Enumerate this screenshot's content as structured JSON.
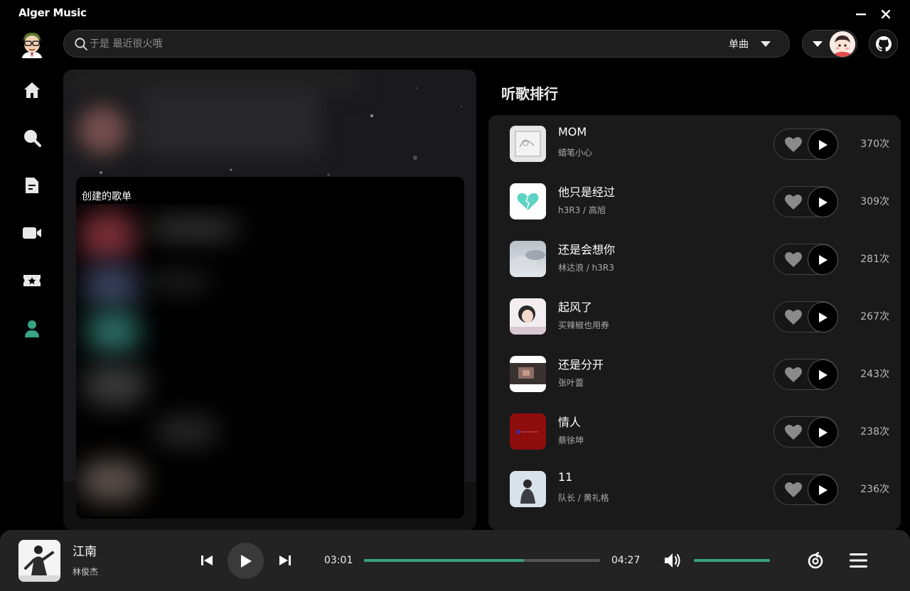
{
  "app": {
    "title": "Alger Music"
  },
  "colors": {
    "accent": "#37a383",
    "background": "#000000",
    "panel": "#1a1a1a"
  },
  "search": {
    "placeholder": "于是 最近很火哦",
    "type_label": "单曲"
  },
  "sidebar": {
    "items": [
      {
        "icon": "home-icon",
        "active": false
      },
      {
        "icon": "search-icon",
        "active": false
      },
      {
        "icon": "document-icon",
        "active": false
      },
      {
        "icon": "video-icon",
        "active": false
      },
      {
        "icon": "ticket-star-icon",
        "active": false
      },
      {
        "icon": "user-icon",
        "active": true
      }
    ]
  },
  "left_panel": {
    "playlist_heading": "创建的歌单"
  },
  "ranking": {
    "title": "听歌排行",
    "items": [
      {
        "name": "MOM",
        "artist": "蜡笔小心",
        "count": "370次"
      },
      {
        "name": "他只是经过",
        "artist": "h3R3 / 高旭",
        "count": "309次"
      },
      {
        "name": "还是会想你",
        "artist": "林达浪 / h3R3",
        "count": "281次"
      },
      {
        "name": "起风了",
        "artist": "买辣椒也用券",
        "count": "267次"
      },
      {
        "name": "还是分开",
        "artist": "张叶蕾",
        "count": "243次"
      },
      {
        "name": "情人",
        "artist": "蔡徐坤",
        "count": "238次"
      },
      {
        "name": "11",
        "artist": "队长 / 黄礼格",
        "count": "236次"
      }
    ]
  },
  "player": {
    "title": "江南",
    "artist": "林俊杰",
    "current_time": "03:01",
    "total_time": "04:27",
    "progress": 0.678,
    "volume": 1.0
  }
}
